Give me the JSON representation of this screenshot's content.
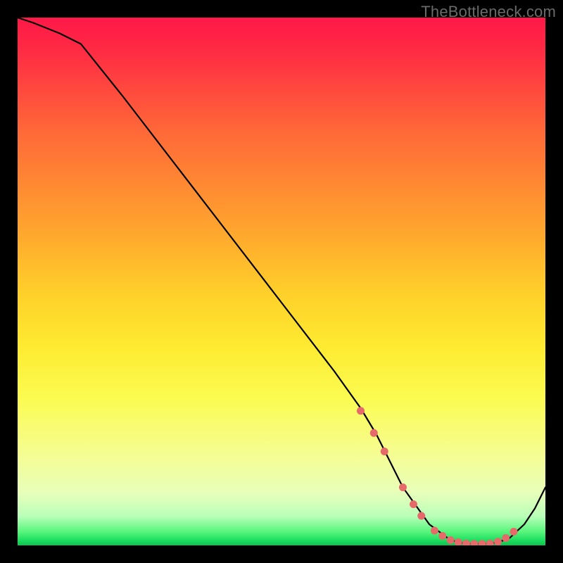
{
  "domain": "Chart",
  "watermark": "TheBottleneck.com",
  "chart_data": {
    "type": "line",
    "title": "",
    "xlabel": "",
    "ylabel": "",
    "xlim": [
      0,
      100
    ],
    "ylim": [
      0,
      100
    ],
    "background_gradient": "vertical-spectrum-red-to-green",
    "series": [
      {
        "name": "bottleneck-curve",
        "style": "black-line",
        "x": [
          0,
          3,
          8,
          12,
          20,
          30,
          40,
          50,
          60,
          65,
          68,
          70,
          73,
          78,
          82,
          85,
          88,
          90,
          93,
          96,
          98,
          100
        ],
        "values": [
          100,
          99,
          97,
          95,
          85,
          72,
          59,
          46,
          33,
          26,
          21,
          17,
          11,
          4,
          1,
          0.3,
          0.3,
          0.4,
          1.2,
          4,
          7,
          11
        ]
      },
      {
        "name": "highlight-dots",
        "style": "salmon-dots",
        "x": [
          65.0,
          67.5,
          69.5,
          73.0,
          75.0,
          76.5,
          79.0,
          80.5,
          82.0,
          83.5,
          85.0,
          86.5,
          88.0,
          89.5,
          91.0,
          92.5,
          94.0
        ],
        "values": [
          25.5,
          21.3,
          17.8,
          11.0,
          7.8,
          5.6,
          2.8,
          1.8,
          1.0,
          0.6,
          0.35,
          0.3,
          0.3,
          0.35,
          0.7,
          1.4,
          2.6
        ]
      }
    ]
  },
  "colors": {
    "curve": "#000000",
    "dots": "#e66a6a",
    "watermark": "#6a6a6a"
  }
}
